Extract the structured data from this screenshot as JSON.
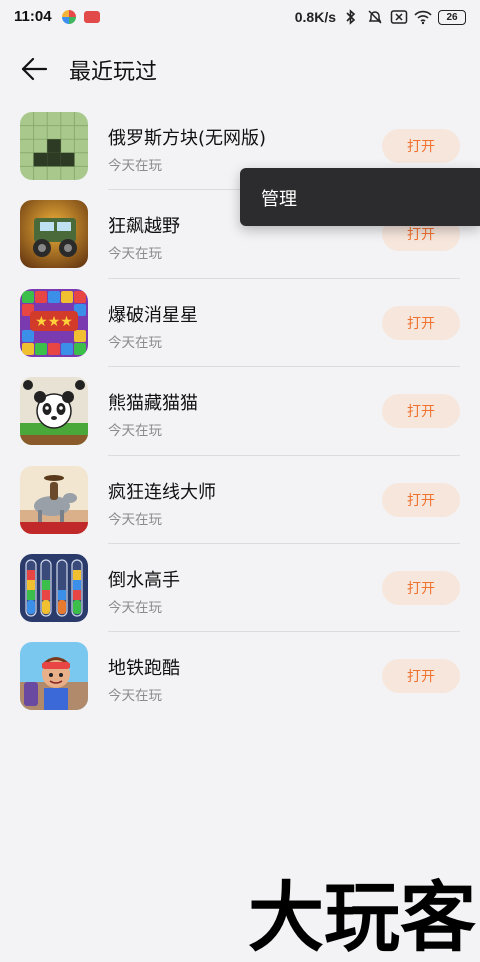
{
  "status_bar": {
    "time": "11:04",
    "network_speed": "0.8K/s",
    "battery": "26",
    "icons": [
      "app-notification-icon",
      "app-notification-icon",
      "bluetooth-icon",
      "mute-icon",
      "sim-off-icon",
      "wifi-icon",
      "battery-icon"
    ]
  },
  "header": {
    "title": "最近玩过",
    "back_icon": "back-arrow-icon"
  },
  "games": [
    {
      "name": "俄罗斯方块(无网版)",
      "subtitle": "今天在玩",
      "action": "打开",
      "icon": "tetris-icon"
    },
    {
      "name": "狂飙越野",
      "subtitle": "今天在玩",
      "action": "打开",
      "icon": "offroad-truck-icon"
    },
    {
      "name": "爆破消星星",
      "subtitle": "今天在玩",
      "action": "打开",
      "icon": "star-blocks-icon"
    },
    {
      "name": "熊猫藏猫猫",
      "subtitle": "今天在玩",
      "action": "打开",
      "icon": "panda-icon"
    },
    {
      "name": "疯狂连线大师",
      "subtitle": "今天在玩",
      "action": "打开",
      "icon": "cowboy-horse-icon"
    },
    {
      "name": "倒水高手",
      "subtitle": "今天在玩",
      "action": "打开",
      "icon": "water-tubes-icon"
    },
    {
      "name": "地铁跑酷",
      "subtitle": "今天在玩",
      "action": "打开",
      "icon": "subway-runner-icon"
    }
  ],
  "popup_menu": {
    "items": [
      "管理"
    ]
  },
  "watermark": "大玩客",
  "colors": {
    "background": "#f3f3f5",
    "accent": "#f0722f",
    "button_bg": "#f6e6dc",
    "popup_bg": "#2c2c2e"
  }
}
